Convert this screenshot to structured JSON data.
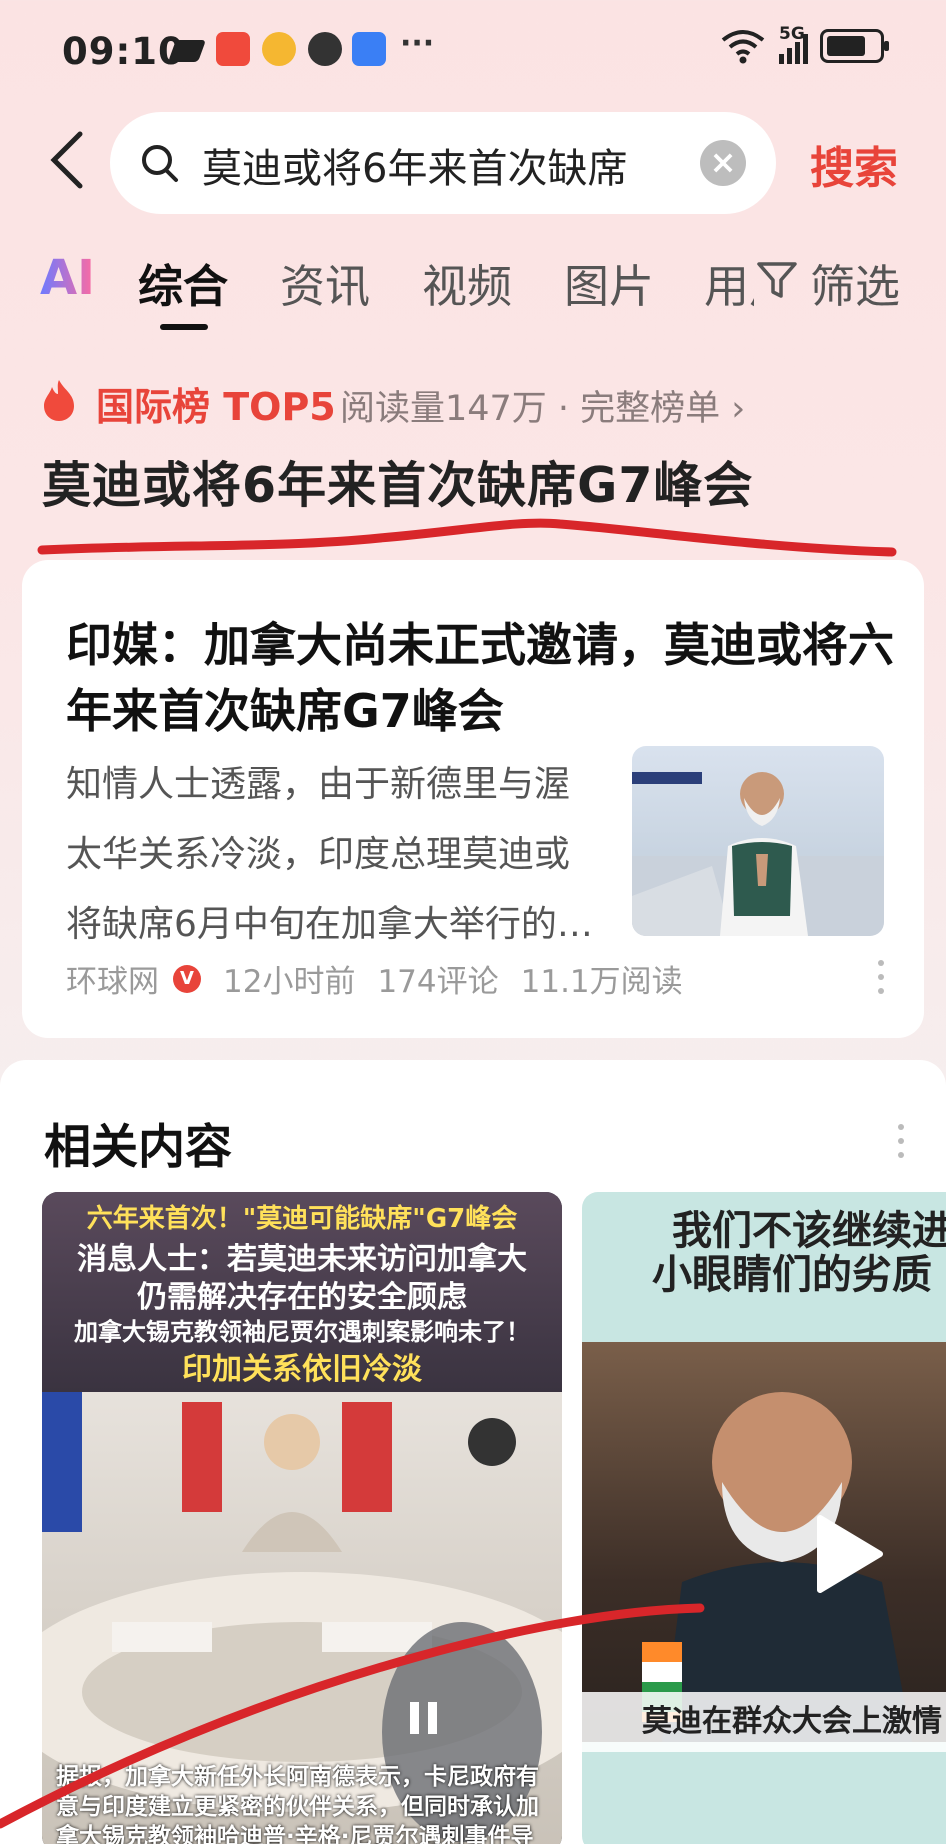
{
  "status_bar": {
    "time": "09:10",
    "more": "···",
    "network": "5G"
  },
  "search": {
    "query": "莫迪或将6年来首次缺席",
    "clear_label": "×",
    "submit_label": "搜索"
  },
  "tabs": [
    {
      "label": "AI"
    },
    {
      "label": "综合"
    },
    {
      "label": "资讯"
    },
    {
      "label": "视频"
    },
    {
      "label": "图片"
    },
    {
      "label": "用户"
    },
    {
      "label": "筛选"
    }
  ],
  "hot_list": {
    "rank_label": "国际榜 TOP5",
    "meta": "阅读量147万 · 完整榜单 ›",
    "headline": "莫迪或将6年来首次缺席G7峰会"
  },
  "news_card": {
    "title": "印媒：加拿大尚未正式邀请，莫迪或将六年来首次缺席G7峰会",
    "summary": "知情人士透露，由于新德里与渥太华关系冷淡，印度总理莫迪或将缺席6月中旬在加拿大举行的…",
    "source": "环球网",
    "verified_badge": "V",
    "time": "12小时前",
    "comments": "174评论",
    "reads": "11.1万阅读"
  },
  "related": {
    "title": "相关内容",
    "video1": {
      "line1": "六年来首次！\"莫迪可能缺席\"G7峰会",
      "line2": "消息人士：若莫迪未来访问加拿大",
      "line3": "仍需解决存在的安全顾虑",
      "line4": "加拿大锡克教领袖尼贾尔遇刺案影响未了！",
      "line5": "印加关系依旧冷淡",
      "caption": "据报，加拿大新任外长阿南德表示，卡尼政府有意与印度建立更紧密的伙伴关系，但同时承认加拿大锡克教领袖哈迪普·辛格·尼贾尔遇刺事件导致"
    },
    "video2": {
      "line1": "我们不该继续进",
      "line2": "小眼睛们的劣质",
      "caption": "莫迪在群众大会上激情"
    }
  },
  "colors": {
    "accent_red": "#e8443a",
    "background_pink": "#fbe3e3"
  }
}
